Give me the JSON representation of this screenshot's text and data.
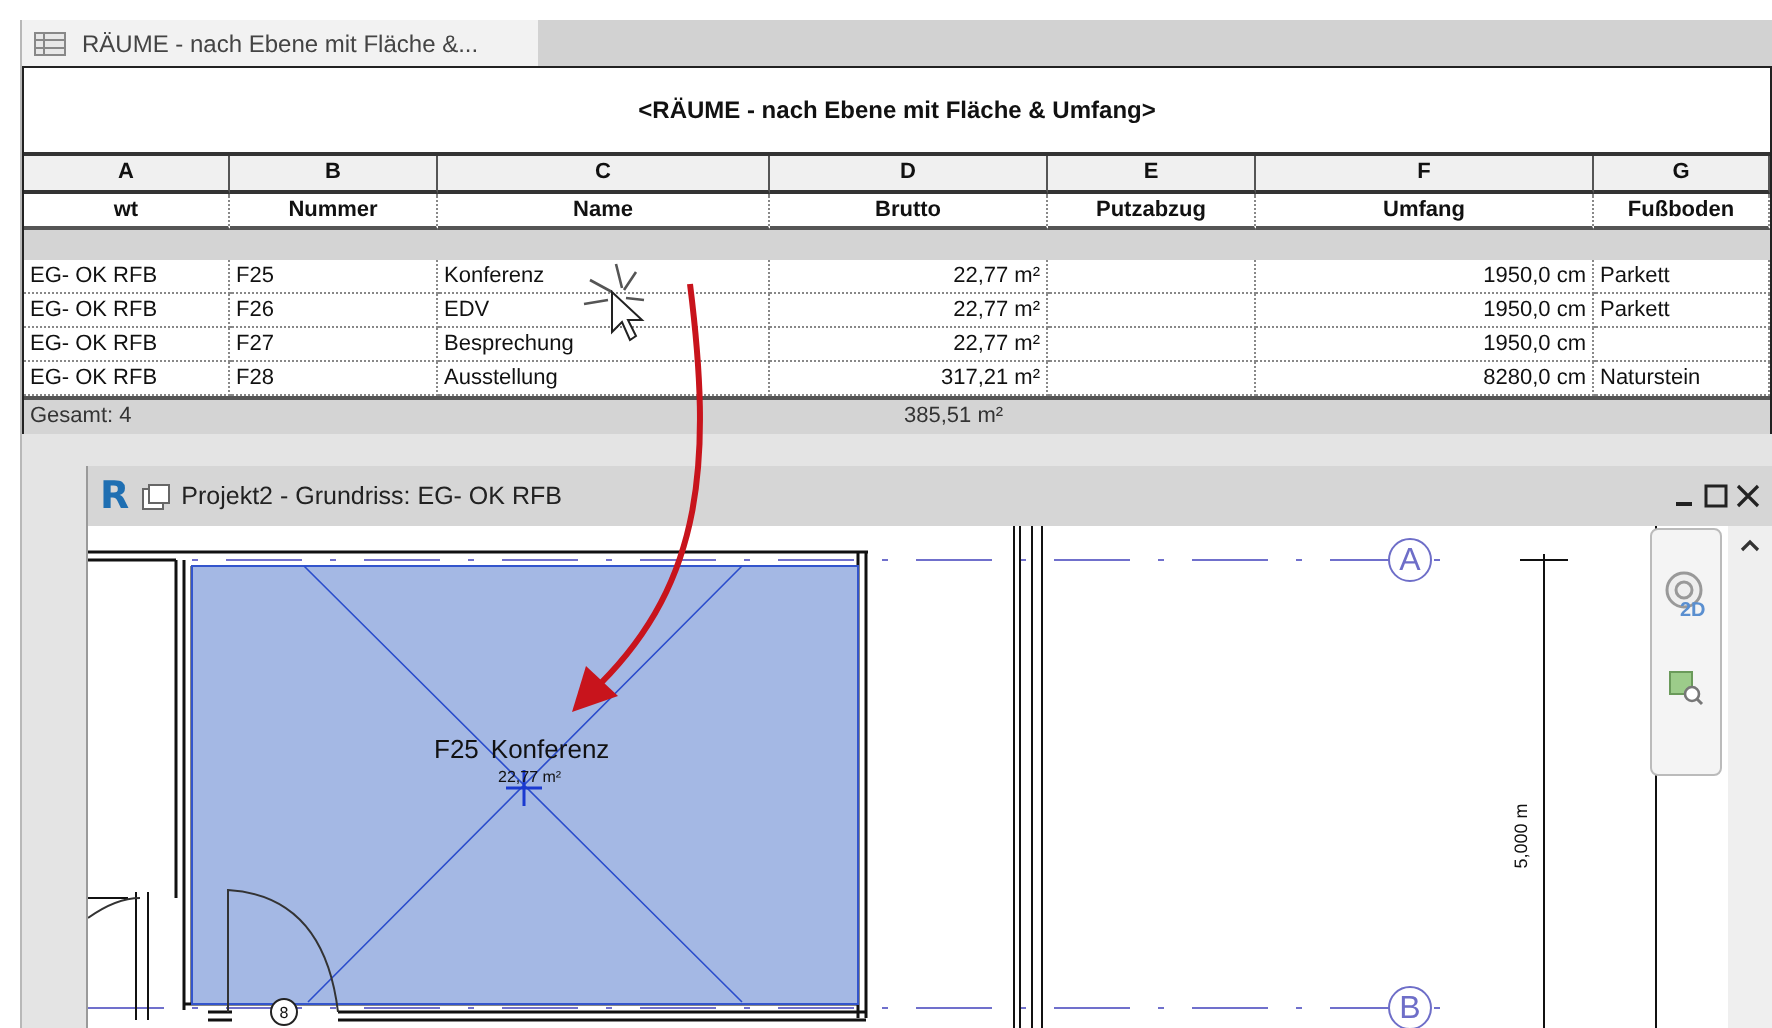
{
  "schedule_tab": {
    "title": "RÄUME - nach Ebene mit Fläche &..."
  },
  "schedule": {
    "title": "<RÄUME - nach Ebene mit Fläche & Umfang>",
    "columns": [
      {
        "letter": "A",
        "label": "wt"
      },
      {
        "letter": "B",
        "label": "Nummer"
      },
      {
        "letter": "C",
        "label": "Name"
      },
      {
        "letter": "D",
        "label": "Brutto"
      },
      {
        "letter": "E",
        "label": "Putzabzug"
      },
      {
        "letter": "F",
        "label": "Umfang"
      },
      {
        "letter": "G",
        "label": "Fußboden"
      }
    ],
    "rows": [
      [
        "EG- OK RFB",
        "F25",
        "Konferenz",
        "22,77 m²",
        null,
        "1950,0 cm",
        "Parkett"
      ],
      [
        "EG- OK RFB",
        "F26",
        "EDV",
        "22,77 m²",
        null,
        "1950,0 cm",
        "Parkett"
      ],
      [
        "EG- OK RFB",
        "F27",
        "Besprechung",
        "22,77 m²",
        null,
        "1950,0 cm",
        null
      ],
      [
        "EG- OK RFB",
        "F28",
        "Ausstellung",
        "317,21 m²",
        null,
        "8280,0 cm",
        "Naturstein"
      ]
    ],
    "total": {
      "label": "Gesamt: 4",
      "brutto": "385,51 m²"
    }
  },
  "view_window": {
    "logo": "R",
    "title": "Projekt2 - Grundriss: EG- OK RFB",
    "room_tag": {
      "number": "F25",
      "name": "Konferenz",
      "area": "22,77 m²"
    },
    "grid_labels": [
      "A",
      "B"
    ],
    "door_tag": "8",
    "dimension": "5,000 m",
    "nav_label": "2D"
  }
}
